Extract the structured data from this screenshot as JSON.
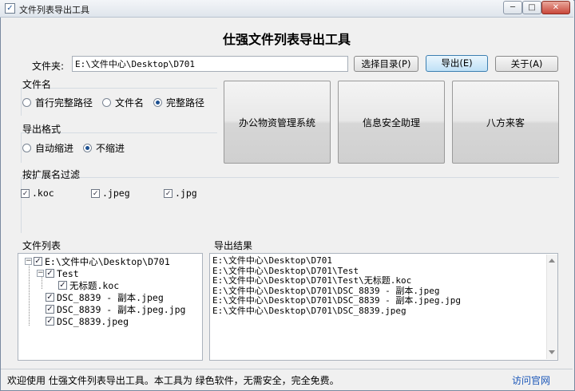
{
  "window": {
    "title": "文件列表导出工具"
  },
  "window_controls": {
    "minimize": "─",
    "maximize": "□",
    "close": "✕"
  },
  "heading": "仕强文件列表导出工具",
  "folder": {
    "label": "文件夹:",
    "value": "E:\\文件中心\\Desktop\\D701"
  },
  "buttons": {
    "choose_dir": "选择目录(P)",
    "export": "导出(E)",
    "about": "关于(A)"
  },
  "filename_group": {
    "label": "文件名",
    "options": [
      "首行完整路径",
      "文件名",
      "完整路径"
    ],
    "selected": "完整路径"
  },
  "format_group": {
    "label": "导出格式",
    "options": [
      "自动缩进",
      "不缩进"
    ],
    "selected": "不缩进"
  },
  "ad_buttons": [
    "办公物资管理系统",
    "信息安全助理",
    "八方来客"
  ],
  "filter_group": {
    "label": "按扩展名过滤",
    "extensions": [
      ".koc",
      ".jpeg",
      ".jpg"
    ]
  },
  "file_list": {
    "label": "文件列表",
    "root": "E:\\文件中心\\Desktop\\D701",
    "folder": "Test",
    "folder_child": "无标题.koc",
    "files": [
      "DSC_8839 - 副本.jpeg",
      "DSC_8839 - 副本.jpeg.jpg",
      "DSC_8839.jpeg"
    ]
  },
  "export_result": {
    "label": "导出结果",
    "lines": [
      "E:\\文件中心\\Desktop\\D701",
      "E:\\文件中心\\Desktop\\D701\\Test",
      "E:\\文件中心\\Desktop\\D701\\Test\\无标题.koc",
      "E:\\文件中心\\Desktop\\D701\\DSC_8839 - 副本.jpeg",
      "E:\\文件中心\\Desktop\\D701\\DSC_8839 - 副本.jpeg.jpg",
      "E:\\文件中心\\Desktop\\D701\\DSC_8839.jpeg"
    ]
  },
  "status": {
    "text": "欢迎使用 仕强文件列表导出工具。本工具为 绿色软件，无需安全，完全免费。",
    "link": "访问官网"
  },
  "colors": {
    "accent": "#3c7fb1",
    "link": "#1a56b8",
    "close": "#c9473a"
  }
}
